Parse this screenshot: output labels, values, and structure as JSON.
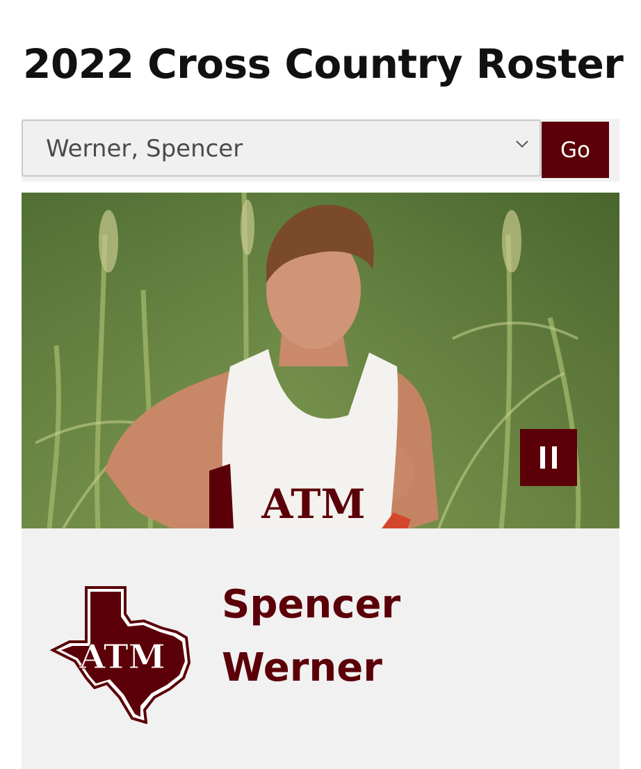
{
  "page": {
    "title": "2022 Cross Country Roster"
  },
  "roster_select": {
    "selected_value": "Werner, Spencer"
  },
  "go_button": {
    "label": "Go"
  },
  "carousel": {
    "pause_icon": "pause-icon"
  },
  "player": {
    "first_name": "Spencer",
    "last_name": "Werner"
  },
  "colors": {
    "maroon": "#5b0008",
    "panel": "#f1f1f1",
    "title": "#111111"
  }
}
